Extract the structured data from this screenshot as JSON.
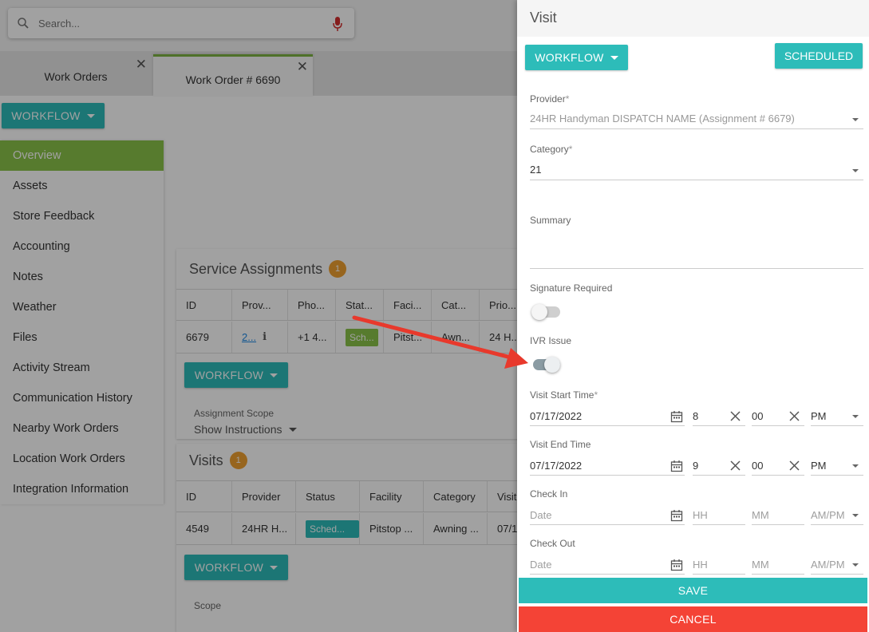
{
  "search": {
    "placeholder": "Search..."
  },
  "tabs": [
    {
      "label": "Work Orders"
    },
    {
      "label": "Work Order # 6690"
    }
  ],
  "workflow_label": "WORKFLOW",
  "sidebar": {
    "items": [
      {
        "label": "Overview"
      },
      {
        "label": "Assets"
      },
      {
        "label": "Store Feedback"
      },
      {
        "label": "Accounting"
      },
      {
        "label": "Notes"
      },
      {
        "label": "Weather"
      },
      {
        "label": "Files"
      },
      {
        "label": "Activity Stream"
      },
      {
        "label": "Communication History"
      },
      {
        "label": "Nearby Work Orders"
      },
      {
        "label": "Location Work Orders"
      },
      {
        "label": "Integration Information"
      }
    ]
  },
  "service_assignments": {
    "title": "Service Assignments",
    "count": "1",
    "columns": [
      "ID",
      "Prov...",
      "Pho...",
      "Stat...",
      "Faci...",
      "Cat...",
      "Prio..."
    ],
    "row": {
      "id": "6679",
      "provider": "2...",
      "phone": "+1 4...",
      "status": "Sch...",
      "facility": "Pitst...",
      "category": "Awn...",
      "priority": "24 H..."
    },
    "scope_label": "Assignment Scope",
    "scope_link": "Show Instructions"
  },
  "visits": {
    "title": "Visits",
    "count": "1",
    "columns": [
      "ID",
      "Provider",
      "Status",
      "Facility",
      "Category",
      "Visit"
    ],
    "row": {
      "id": "4549",
      "provider": "24HR H...",
      "status": "Sched...",
      "facility": "Pitstop ...",
      "category": "Awning ...",
      "visit": "07/1"
    },
    "scope_label": "Scope"
  },
  "panel": {
    "title": "Visit",
    "status_button": "SCHEDULED",
    "provider": {
      "label": "Provider",
      "value": "24HR Handyman DISPATCH NAME (Assignment # 6679)"
    },
    "category": {
      "label": "Category",
      "value": "21"
    },
    "summary": {
      "label": "Summary"
    },
    "signature": {
      "label": "Signature Required",
      "on": false
    },
    "ivr": {
      "label": "IVR Issue",
      "on": true
    },
    "start": {
      "label": "Visit Start Time",
      "date": "07/17/2022",
      "hour": "8",
      "minute": "00",
      "ampm": "PM"
    },
    "end": {
      "label": "Visit End Time",
      "date": "07/17/2022",
      "hour": "9",
      "minute": "00",
      "ampm": "PM"
    },
    "checkin": {
      "label": "Check In",
      "date_ph": "Date",
      "hour_ph": "HH",
      "minute_ph": "MM",
      "ampm_ph": "AM/PM"
    },
    "checkout": {
      "label": "Check Out",
      "date_ph": "Date",
      "hour_ph": "HH",
      "minute_ph": "MM",
      "ampm_ph": "AM/PM"
    },
    "save": "SAVE",
    "cancel": "CANCEL",
    "required_mark": "*"
  },
  "colors": {
    "teal": "#2dbcb9",
    "green": "#8bc34a",
    "red": "#f44336",
    "badge": "#f0a030",
    "annotation_arrow": "#e8392c"
  }
}
